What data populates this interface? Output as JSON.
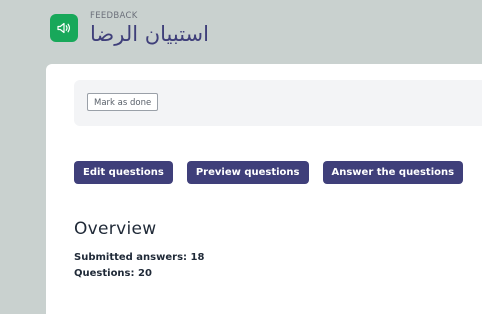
{
  "header": {
    "module_type": "FEEDBACK",
    "title": "استبيان الرضا",
    "icon": "megaphone-icon",
    "icon_bg_color": "#18a85a"
  },
  "completion": {
    "mark_as_done_label": "Mark as done"
  },
  "actions": {
    "edit_label": "Edit questions",
    "preview_label": "Preview questions",
    "answer_label": "Answer the questions"
  },
  "overview": {
    "title": "Overview",
    "submitted_answers": "Submitted answers: 18",
    "questions": "Questions: 20"
  },
  "colors": {
    "primary": "#3f3f7a",
    "page_bg": "#c9d1cf"
  }
}
